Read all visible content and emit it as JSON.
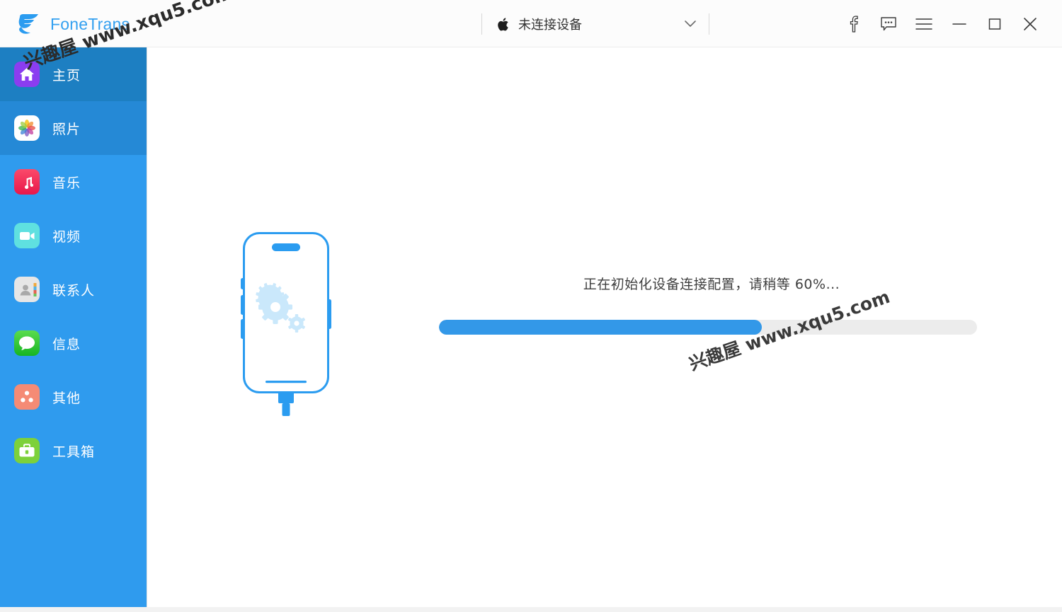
{
  "app": {
    "brand_name": "FoneTrans",
    "logo_icon": "fonetrans-feather-logo",
    "accent_color": "#33a0f0",
    "sidebar_color": "#2f9bee",
    "sidebar_selected_color": "#1d7fc2",
    "sidebar_hover_color": "#2589d6"
  },
  "titlebar": {
    "device_selector": {
      "platform_icon": "apple-icon",
      "label": "未连接设备",
      "chevron_icon": "chevron-down-icon"
    },
    "actions": [
      {
        "name": "facebook-button",
        "icon": "facebook-icon",
        "label": "f"
      },
      {
        "name": "feedback-button",
        "icon": "chat-bubble-icon",
        "label": ""
      },
      {
        "name": "menu-button",
        "icon": "hamburger-menu-icon",
        "label": ""
      },
      {
        "name": "minimize-button",
        "icon": "minimize-icon",
        "label": ""
      },
      {
        "name": "maximize-button",
        "icon": "maximize-icon",
        "label": ""
      },
      {
        "name": "close-button",
        "icon": "close-icon",
        "label": ""
      }
    ]
  },
  "sidebar": {
    "items": [
      {
        "label": "主页",
        "icon": "home-icon",
        "state": "selected"
      },
      {
        "label": "照片",
        "icon": "photos-icon",
        "state": "hover"
      },
      {
        "label": "音乐",
        "icon": "music-icon",
        "state": "normal"
      },
      {
        "label": "视频",
        "icon": "video-icon",
        "state": "normal"
      },
      {
        "label": "联系人",
        "icon": "contacts-icon",
        "state": "normal"
      },
      {
        "label": "信息",
        "icon": "messages-icon",
        "state": "normal"
      },
      {
        "label": "其他",
        "icon": "other-icon",
        "state": "normal"
      },
      {
        "label": "工具箱",
        "icon": "toolbox-icon",
        "state": "normal"
      }
    ]
  },
  "main": {
    "illustration_icon": "iphone-with-gears-illustration",
    "status_text": "正在初始化设备连接配置，请稍等 60%...",
    "progress": {
      "percent": 60,
      "fill_color": "#3398e8",
      "track_color": "#ececec"
    }
  },
  "watermark": {
    "text": "兴趣屋 www.xqu5.com"
  }
}
